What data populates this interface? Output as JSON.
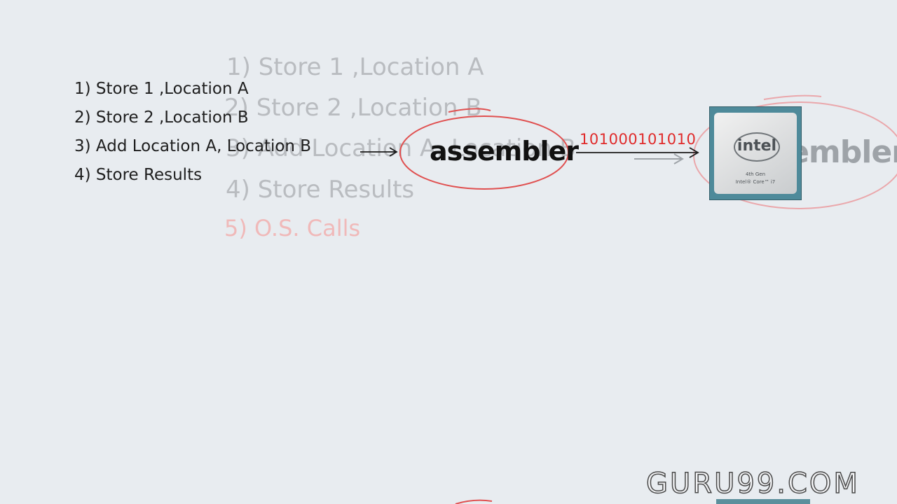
{
  "instructions": [
    "1) Store 1 ,Location A",
    "2) Store 2 ,Location B",
    "3) Add Location A, Location B",
    "4) Store Results"
  ],
  "ghost_instructions": [
    "1) Store 1 ,Location A",
    "2) Store 2 ,Location B",
    "3) Add Location A, Location B",
    "4) Store Results"
  ],
  "ghost_os_call": "5) O.S. Calls",
  "assembler_label": "assembler",
  "ghost_assembler_label": "assembler",
  "binary_output": "101000101010",
  "cpu": {
    "logo": "intel",
    "gen": "4th Gen",
    "model": "Intel® Core™ i7"
  },
  "watermark": "GURU99.COM",
  "colors": {
    "annotation_red": "#e02b2b",
    "background": "#e8ecf0"
  }
}
